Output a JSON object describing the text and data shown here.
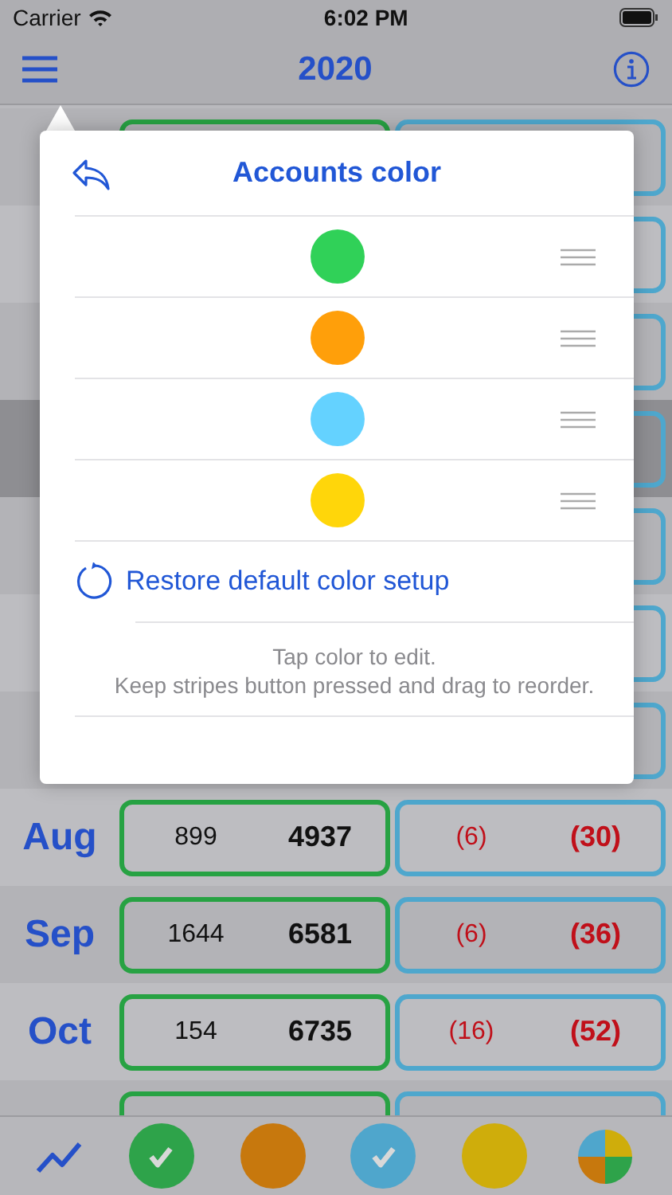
{
  "status_bar": {
    "carrier": "Carrier",
    "time": "6:02 PM"
  },
  "nav": {
    "title": "2020"
  },
  "months": [
    {
      "highlighted": false
    },
    {
      "highlighted": false
    },
    {
      "highlighted": false
    },
    {
      "highlighted": true
    },
    {
      "highlighted": false
    },
    {
      "highlighted": false
    },
    {
      "highlighted": false
    },
    {
      "month": "Aug",
      "highlighted": false,
      "green_small": "899",
      "green_total": "4937",
      "blue_small": "(6)",
      "blue_total": "(30)"
    },
    {
      "month": "Sep",
      "highlighted": false,
      "green_small": "1644",
      "green_total": "6581",
      "blue_small": "(6)",
      "blue_total": "(36)"
    },
    {
      "month": "Oct",
      "highlighted": false,
      "green_small": "154",
      "green_total": "6735",
      "blue_small": "(16)",
      "blue_total": "(52)"
    },
    {
      "highlighted": false
    }
  ],
  "popover": {
    "title": "Accounts color",
    "colors": [
      {
        "color": "#30d158"
      },
      {
        "color": "#ff9f0a"
      },
      {
        "color": "#64d2ff"
      },
      {
        "color": "#ffd60a"
      }
    ],
    "restore": "Restore default color setup",
    "hint": [
      "Tap color to edit.",
      "Keep stripes button pressed and drag to reorder."
    ]
  },
  "tab_bar": {
    "accounts": [
      {
        "color": "#2ea34a",
        "checked": true
      },
      {
        "color": "#c7780d",
        "checked": false
      },
      {
        "color": "#4fa6cc",
        "checked": true
      },
      {
        "color": "#cfad0b",
        "checked": false
      }
    ]
  }
}
